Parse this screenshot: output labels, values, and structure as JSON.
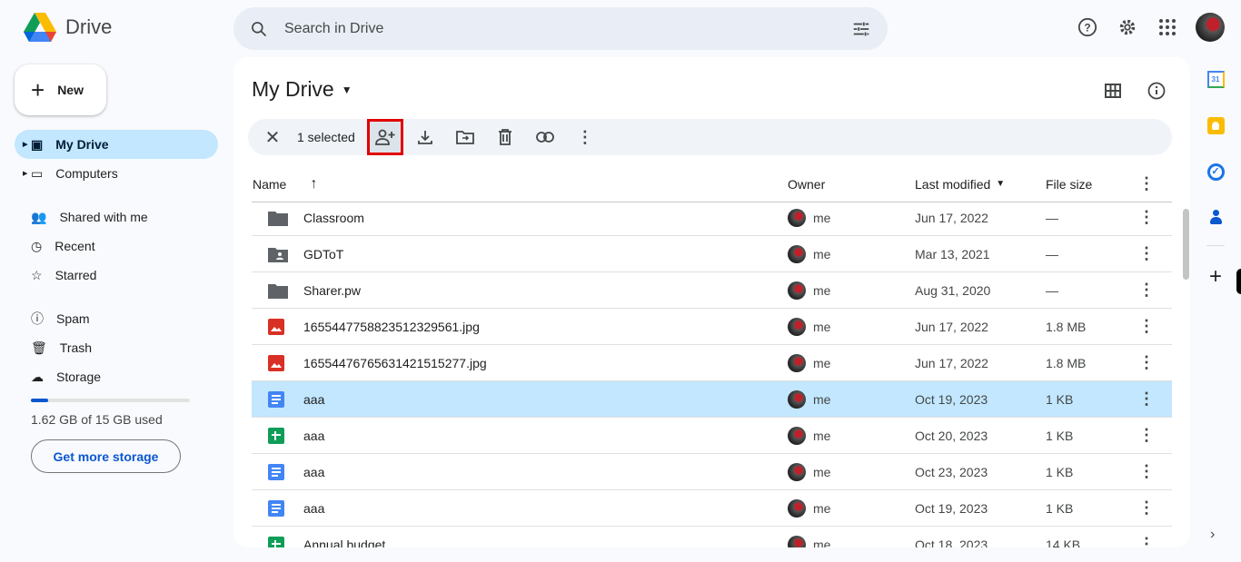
{
  "app": {
    "name": "Drive"
  },
  "search": {
    "placeholder": "Search in Drive"
  },
  "sidebar": {
    "new_label": "New",
    "items": [
      {
        "label": "My Drive",
        "icon": "my-drive-icon",
        "active": true
      },
      {
        "label": "Computers",
        "icon": "computers-icon"
      },
      {
        "label": "Shared with me",
        "icon": "people-icon"
      },
      {
        "label": "Recent",
        "icon": "clock-icon"
      },
      {
        "label": "Starred",
        "icon": "star-icon"
      },
      {
        "label": "Spam",
        "icon": "spam-icon"
      },
      {
        "label": "Trash",
        "icon": "trash-icon"
      },
      {
        "label": "Storage",
        "icon": "cloud-icon"
      }
    ],
    "storage": {
      "text": "1.62 GB of 15 GB used",
      "used_fraction": 0.108,
      "button": "Get more storage"
    }
  },
  "main": {
    "title": "My Drive",
    "selection": {
      "count_label": "1 selected"
    },
    "columns": {
      "name": "Name",
      "owner": "Owner",
      "modified": "Last modified",
      "size": "File size"
    },
    "files": [
      {
        "name": "Classroom",
        "type": "folder",
        "owner": "me",
        "modified": "Jun 17, 2022",
        "size": "—"
      },
      {
        "name": "GDToT",
        "type": "shared-folder",
        "owner": "me",
        "modified": "Mar 13, 2021",
        "size": "—"
      },
      {
        "name": "Sharer.pw",
        "type": "folder",
        "owner": "me",
        "modified": "Aug 31, 2020",
        "size": "—"
      },
      {
        "name": "1655447758823512329561.jpg",
        "type": "image",
        "owner": "me",
        "modified": "Jun 17, 2022",
        "size": "1.8 MB"
      },
      {
        "name": "1655447676563142151527​7.jpg",
        "type": "image",
        "owner": "me",
        "modified": "Jun 17, 2022",
        "size": "1.8 MB"
      },
      {
        "name": "aaa",
        "type": "doc",
        "owner": "me",
        "modified": "Oct 19, 2023",
        "size": "1 KB",
        "selected": true
      },
      {
        "name": "aaa",
        "type": "sheet",
        "owner": "me",
        "modified": "Oct 20, 2023",
        "size": "1 KB"
      },
      {
        "name": "aaa",
        "type": "doc",
        "owner": "me",
        "modified": "Oct 23, 2023",
        "size": "1 KB"
      },
      {
        "name": "aaa",
        "type": "doc",
        "owner": "me",
        "modified": "Oct 19, 2023",
        "size": "1 KB"
      },
      {
        "name": "Annual budget",
        "type": "sheet",
        "owner": "me",
        "modified": "Oct 18, 2023",
        "size": "14 KB"
      }
    ]
  },
  "colors": {
    "accent": "#0b57d0",
    "selected_row": "#c2e7ff",
    "highlight_box": "#e00000"
  }
}
